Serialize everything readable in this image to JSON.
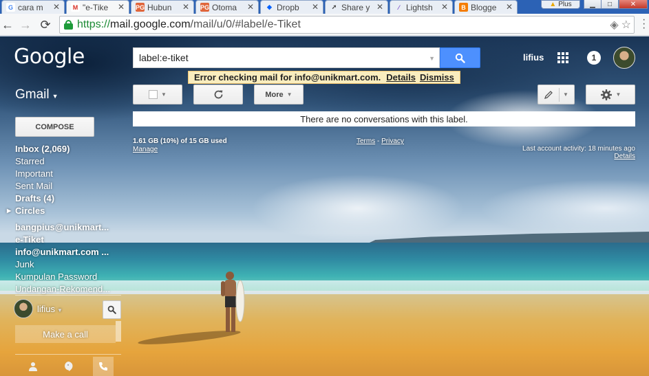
{
  "browser": {
    "tabs": [
      {
        "title": "cara m",
        "favicon": "G",
        "color": "#4285f4"
      },
      {
        "title": "\"e-Tike",
        "favicon": "M",
        "color": "#d93025"
      },
      {
        "title": "Hubun",
        "favicon": "PG",
        "color": "#e0663c"
      },
      {
        "title": "Otoma",
        "favicon": "PG",
        "color": "#e0663c"
      },
      {
        "title": "Dropb",
        "favicon": "◆",
        "color": "#0061fe"
      },
      {
        "title": "Share y",
        "favicon": "➚",
        "color": "#444444"
      },
      {
        "title": "Lightsh",
        "favicon": "⁄",
        "color": "#7b4fc9"
      },
      {
        "title": "Blogge",
        "favicon": "B",
        "color": "#f57d00"
      }
    ],
    "profile_badge": "Plus",
    "url_secure": "https://",
    "url_host": "mail.google.com",
    "url_path": "/mail/u/0/#label/e-Tiket"
  },
  "header": {
    "logo": "Google",
    "search_value": "label:e-tiket",
    "user_name": "lifius",
    "notification_count": "1"
  },
  "error": {
    "message": "Error checking mail for info@unikmart.com.",
    "details": "Details",
    "dismiss": "Dismiss"
  },
  "gmail_label": "Gmail",
  "toolbar": {
    "more_label": "More"
  },
  "compose_label": "COMPOSE",
  "nav": {
    "inbox": "Inbox (2,069)",
    "starred": "Starred",
    "important": "Important",
    "sent": "Sent Mail",
    "drafts": "Drafts (4)",
    "circles": "Circles",
    "label1": "bangpius@unikmart...",
    "label2": "e-Tiket",
    "label3": "info@unikmart.com ...",
    "label4": "Junk",
    "label5": "Kumpulan Password",
    "label6": "Undangan-Rekomend..."
  },
  "hangouts": {
    "name": "lifius",
    "make_call": "Make a call"
  },
  "main": {
    "empty_message": "There are no conversations with this label."
  },
  "footer": {
    "storage": "1.61 GB (10%) of 15 GB used",
    "manage": "Manage",
    "terms": "Terms",
    "separator": "-",
    "privacy": "Privacy",
    "last_activity": "Last account activity: 18 minutes ago",
    "details": "Details"
  }
}
